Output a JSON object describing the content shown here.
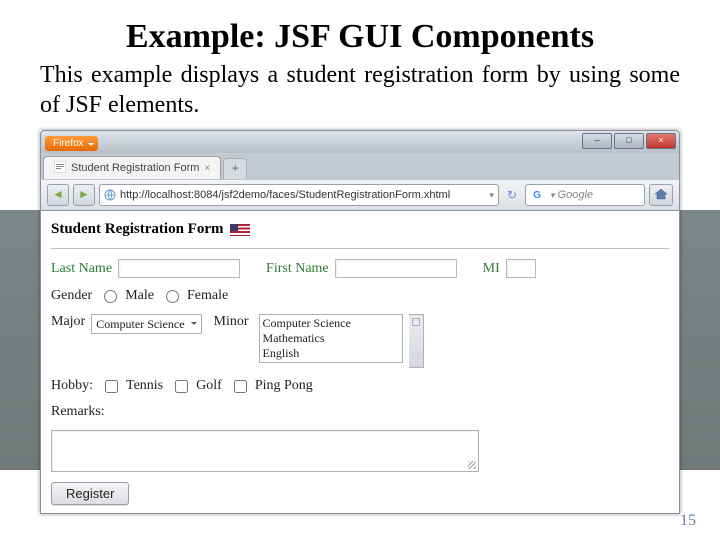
{
  "slide": {
    "title": "Example: JSF GUI Components",
    "description": "This example displays a student registration form by using some of JSF elements.",
    "page_number": "15"
  },
  "browser": {
    "app_name": "Firefox",
    "win_min": "–",
    "win_max": "□",
    "win_close": "×",
    "tab_title": "Student Registration Form",
    "tab_add": "+",
    "nav_back": "◄",
    "nav_fwd": "►",
    "url": "http://localhost:8084/jsf2demo/faces/StudentRegistrationForm.xhtml",
    "url_dropdown": "▾",
    "url_reload": "↻",
    "search_placeholder": "Google",
    "search_dropdown": "▾"
  },
  "form": {
    "heading": "Student Registration Form",
    "labels": {
      "last_name": "Last Name",
      "first_name": "First Name",
      "mi": "MI",
      "gender": "Gender",
      "male": "Male",
      "female": "Female",
      "major": "Major",
      "minor": "Minor",
      "hobby": "Hobby:",
      "tennis": "Tennis",
      "golf": "Golf",
      "pingpong": "Ping Pong",
      "remarks": "Remarks:"
    },
    "major_selected": "Computer Science",
    "minor_options": [
      "Computer Science",
      "Mathematics",
      "English"
    ],
    "register_button": "Register"
  }
}
